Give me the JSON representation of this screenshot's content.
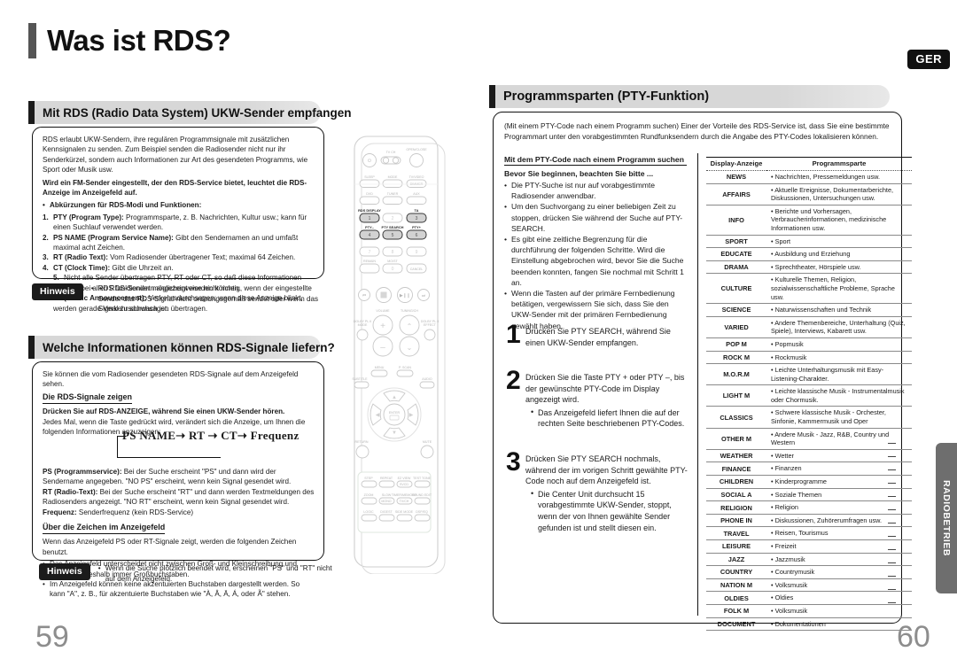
{
  "doc": {
    "title": "Was ist RDS?",
    "lang_badge": "GER",
    "side_tab": "RADIOBETRIEB",
    "page_left": "59",
    "page_right": "60"
  },
  "left": {
    "section1": {
      "heading": "Mit RDS (Radio Data System) UKW-Sender empfangen",
      "intro": "RDS erlaubt UKW-Sendern, ihre regulären Programmsignale mit zusätzlichen Kennsignalen zu senden. Zum Beispiel senden die Radiosender nicht nur ihr Senderkürzel, sondern auch Informationen zur Art des gesendeten Programms, wie Sport oder Musik usw.",
      "bold_note": "Wird ein FM-Sender eingestellt, der den RDS-Service bietet, leuchtet die RDS-Anzeige im Anzeigefeld auf.",
      "abbrev_title": "Abkürzungen für RDS-Modi und Funktionen:",
      "items": [
        {
          "bold": "PTY (Program Type):",
          "rest": " Programmsparte, z. B. Nachrichten, Kultur usw.; kann für einen Suchlauf verwendet werden."
        },
        {
          "bold": "PS NAME (Program Service Name):",
          "rest": " Gibt den Sendernamen an und umfaßt maximal acht Zeichen."
        },
        {
          "bold": "RT (Radio Text):",
          "rest": " Vom Radiosender übertragener Text; maximal 64 Zeichen."
        },
        {
          "bold": "CT (Clock Time):",
          "rest": " Gibt die Uhrzeit an."
        },
        {
          "bold": "TA (Traffic Announcement):",
          "rest": " Verkehrsdurchsagen; wenn diese Anzeige blinkt, werden gerade Verkehrsdurchsagen übertragen."
        }
      ],
      "ct_subnote": "Nicht alle Sender übertragen PTY, RT oder CT, so daß diese Informationen nicht bei allen RDS-Sendern angezeigt werden können.",
      "hinweis_label": "Hinweis",
      "hinweis_text": "RDS funktioniert möglicherweise nicht richtig, wenn der eingestellte Sender das RDS-Signal nicht ordnungsgemäß sendet oder wenn das Signal zu schwach ist."
    },
    "section2": {
      "heading": "Welche Informationen können RDS-Signale liefern?",
      "intro": "Sie können die vom Radiosender gesendeten RDS-Signale auf dem Anzeigefeld sehen.",
      "sub1_title": "Die RDS-Signale zeigen",
      "sub1_bold": "Drücken Sie auf RDS-ANZEIGE, während Sie einen UKW-Sender hören.",
      "sub1_text": "Jedes Mal, wenn die Taste gedrückt wird, verändert sich die Anzeige, um Ihnen die folgenden Informationen anzuzeigen:",
      "flow": "PS NAME➝ RT ➝ CT➝ Frequenz",
      "defs": [
        {
          "bold": "PS (Programmservice):",
          "rest": " Bei der Suche erscheint \"PS\" und dann wird der Sendername angegeben. \"NO PS\" erscheint, wenn kein Signal gesendet wird."
        },
        {
          "bold": "RT (Radio-Text):",
          "rest": " Bei der Suche erscheint \"RT\" und dann werden Textmeldungen des Radiosenders angezeigt. \"NO RT\" erscheint, wenn kein Signal gesendet wird."
        },
        {
          "bold": "Frequenz:",
          "rest": " Senderfrequenz (kein RDS-Service)"
        }
      ],
      "sub2_title": "Über die Zeichen im Anzeigefeld",
      "sub2_text": "Wenn das Anzeigefeld PS oder RT-Signale zeigt, werden die folgenden Zeichen benutzt.",
      "sub2_bullets": [
        "Das Anzeigefeld unterscheidet nicht zwischen Groß- und Kleinschreibung und verwendet deshalb immer Großbuchstaben.",
        "Im Anzeigefeld können keine akzentuierten Buchstaben dargestellt werden. So kann \"A\", z. B., für akzentuierte Buchstaben wie \"À, Â, Ä, Á,  oder Ã\" stehen."
      ],
      "hinweis_label": "Hinweis",
      "hinweis_text": "Wenn die Suche plötzlich beendet wird, erscheinen \"PS\" und \"RT\" nicht auf dem Anzeigefeld."
    }
  },
  "right": {
    "heading": "Programmsparten (PTY-Funktion)",
    "intro": "(Mit einem PTY-Code nach einem Programm suchen) Einer der Vorteile des RDS-Service ist, dass Sie eine bestimmte Programmart unter den vorabgestimmten Rundfunksendern durch die Angabe des PTY-Codes lokalisieren können.",
    "sub_title": "Mit dem PTY-Code nach einem Programm suchen",
    "before_title": "Bevor Sie beginnen, beachten Sie bitte ...",
    "before_bullets": [
      "Die PTY-Suche ist nur auf vorabgestimmte Radiosender anwendbar.",
      "Um den Suchvorgang zu einer beliebigen Zeit zu stoppen, drücken Sie während der Suche auf PTY-SEARCH.",
      "Es gibt eine zeitliche Begrenzung für die durchführung der folgenden Schritte. Wird die Einstellung abgebrochen wird, bevor Sie die Suche beenden konnten, fangen Sie nochmal mit Schritt 1 an.",
      "Wenn die Tasten auf der primäre Fernbedienung betätigen, vergewissern Sie sich, dass Sie den UKW-Sender mit der primären Fernbedienung gewählt haben."
    ],
    "steps": [
      {
        "num": "1",
        "text": "Drücken Sie PTY SEARCH, während Sie einen UKW-Sender empfangen.",
        "bullets": []
      },
      {
        "num": "2",
        "text": "Drücken Sie die Taste PTY + oder PTY –, bis der gewünschte PTY-Code im Display angezeigt wird.",
        "bullets": [
          "Das Anzeigefeld liefert Ihnen die auf der rechten Seite beschriebenen PTY-Codes."
        ]
      },
      {
        "num": "3",
        "text": "Drücken Sie PTY SEARCH nochmals, während der im vorigen Schritt gewählte PTY-Code noch auf dem Anzeigefeld ist.",
        "bullets": [
          "Die Center Unit durchsucht 15 vorabgestimmte UKW-Sender, stoppt, wenn der von Ihnen gewählte Sender gefunden ist und stellt diesen ein."
        ]
      }
    ]
  },
  "pty_table": {
    "col_code": "Display-Anzeige",
    "col_desc": "Programmsparte",
    "rows": [
      {
        "code": "NEWS",
        "desc": "Nachrichten, Pressemeldungen usw."
      },
      {
        "code": "AFFAIRS",
        "desc": "Aktuelle Ereignisse, Dokumentarberichte, Diskussionen, Untersuchungen usw."
      },
      {
        "code": "INFO",
        "desc": "Berichte und Vorhersagen, Verbraucherinformationen, medizinische Informationen usw."
      },
      {
        "code": "SPORT",
        "desc": "Sport"
      },
      {
        "code": "EDUCATE",
        "desc": "Ausbildung und Erziehung"
      },
      {
        "code": "DRAMA",
        "desc": "Sprechtheater, Hörspiele usw."
      },
      {
        "code": "CULTURE",
        "desc": "Kulturelle Themen, Religion, sozialwissenschaftliche Probleme, Sprache usw."
      },
      {
        "code": "SCIENCE",
        "desc": "Naturwissenschaften und Technik"
      },
      {
        "code": "VARIED",
        "desc": "Andere Themenbereiche, Unterhaltung (Quiz, Spiele), Interviews, Kabarett usw."
      },
      {
        "code": "POP M",
        "desc": "Popmusik"
      },
      {
        "code": "ROCK M",
        "desc": "Rockmusik"
      },
      {
        "code": "M.O.R.M",
        "desc": "Leichte Unterhaltungsmusik mit Easy-Listening-Charakter."
      },
      {
        "code": "LIGHT M",
        "desc": "Leichte klassische Musik - Instrumentalmusik oder Chormusik."
      },
      {
        "code": "CLASSICS",
        "desc": "Schwere klassische Musik - Orchester, Sinfonie, Kammermusik und Oper"
      },
      {
        "code": "OTHER M",
        "desc": "Andere Musik - Jazz, R&B, Country und Western"
      },
      {
        "code": "WEATHER",
        "desc": "Wetter"
      },
      {
        "code": "FINANCE",
        "desc": "Finanzen"
      },
      {
        "code": "CHILDREN",
        "desc": "Kinderprogramme"
      },
      {
        "code": "SOCIAL A",
        "desc": "Soziale Themen"
      },
      {
        "code": "RELIGION",
        "desc": "Religion"
      },
      {
        "code": "PHONE IN",
        "desc": "Diskussionen, Zuhörerumfragen usw."
      },
      {
        "code": "TRAVEL",
        "desc": "Reisen, Tourismus"
      },
      {
        "code": "LEISURE",
        "desc": "Freizeit"
      },
      {
        "code": "JAZZ",
        "desc": "Jazzmusik"
      },
      {
        "code": "COUNTRY",
        "desc": "Countrymusik"
      },
      {
        "code": "NATION M",
        "desc": "Volksmusik"
      },
      {
        "code": "OLDIES",
        "desc": "Oldies"
      },
      {
        "code": "FOLK M",
        "desc": "Volksmusik"
      },
      {
        "code": "DOCUMENT",
        "desc": "Dokumentationen"
      }
    ]
  },
  "remote": {
    "labels": {
      "open_close": "OPEN/CLOSE",
      "tv_ch": "TV  CH",
      "sleep": "SLEEP",
      "mode": "MODE",
      "tv_video": "TV/VIDEO",
      "dvd": "DVD",
      "tuner": "TUNER",
      "aux": "AUX",
      "rds_display": "RDS DISPLAY",
      "ta": "TA",
      "pty_minus": "PTY–",
      "pty_search": "PTY SEARCH",
      "pty_plus": "PTY+",
      "remain": "REMAIN",
      "cancel": "CANCEL",
      "volume": "VOLUME",
      "tuning": "TUNING/CH",
      "enter": "ENTER",
      "return": "RETURN",
      "mute": "MUTE"
    }
  }
}
